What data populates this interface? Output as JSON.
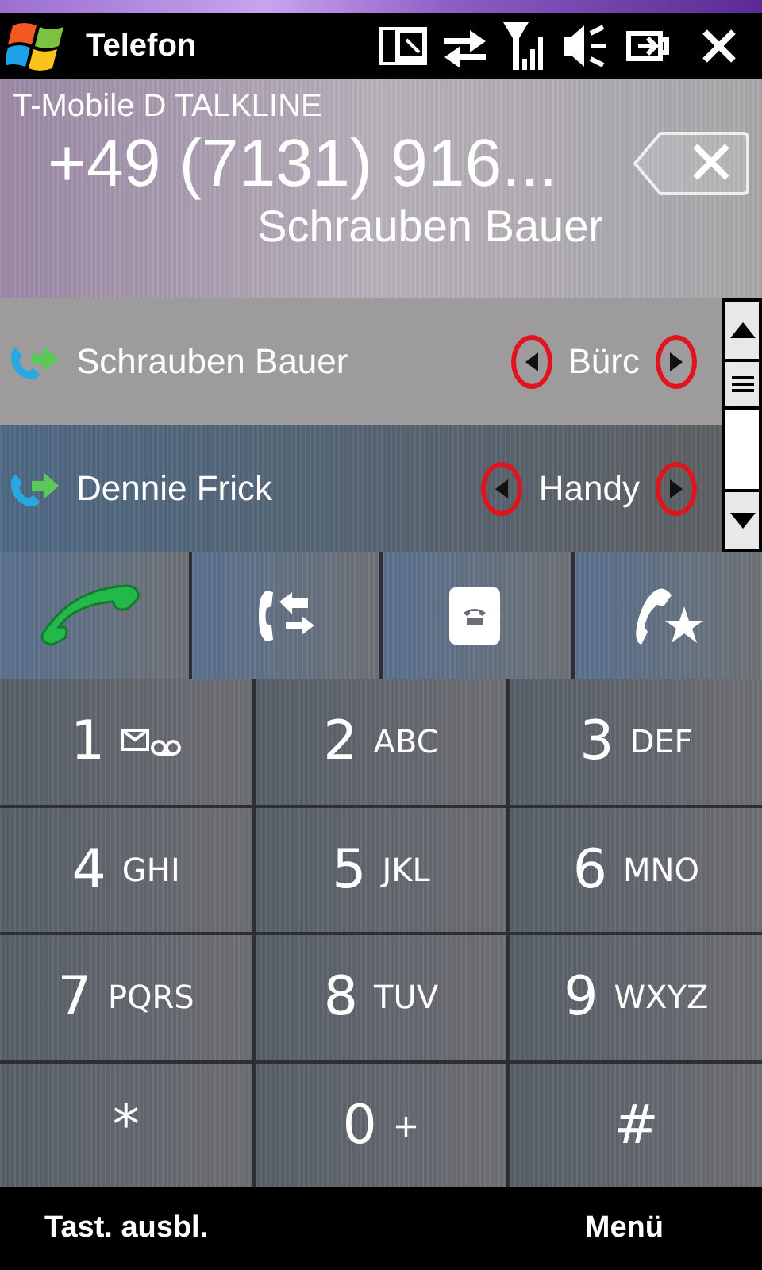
{
  "title_bar": {
    "title": "Telefon"
  },
  "header": {
    "carrier": "T-Mobile D TALKLINE",
    "number": "+49 (7131) 916...",
    "contact": "Schrauben Bauer"
  },
  "matches": [
    {
      "name": "Schrauben Bauer",
      "number_type": "Bürc",
      "selected": true,
      "annotated": true
    },
    {
      "name": "Dennie Frick",
      "number_type": "Handy",
      "selected": false,
      "annotated": true
    }
  ],
  "actions": [
    {
      "kind": "call"
    },
    {
      "kind": "transfer"
    },
    {
      "kind": "contacts"
    },
    {
      "kind": "speed_dial"
    }
  ],
  "keys": [
    {
      "digit": "1",
      "kind": "voicemail"
    },
    {
      "digit": "2",
      "letters": "ABC"
    },
    {
      "digit": "3",
      "letters": "DEF"
    },
    {
      "digit": "4",
      "letters": "GHI"
    },
    {
      "digit": "5",
      "letters": "JKL"
    },
    {
      "digit": "6",
      "letters": "MNO"
    },
    {
      "digit": "7",
      "letters": "PQRS"
    },
    {
      "digit": "8",
      "letters": "TUV"
    },
    {
      "digit": "9",
      "letters": "WXYZ"
    },
    {
      "digit": "*"
    },
    {
      "digit": "0",
      "letters": "+"
    },
    {
      "digit": "#"
    }
  ],
  "soft_keys": {
    "left": "Tast. ausbl.",
    "right": "Menü"
  }
}
